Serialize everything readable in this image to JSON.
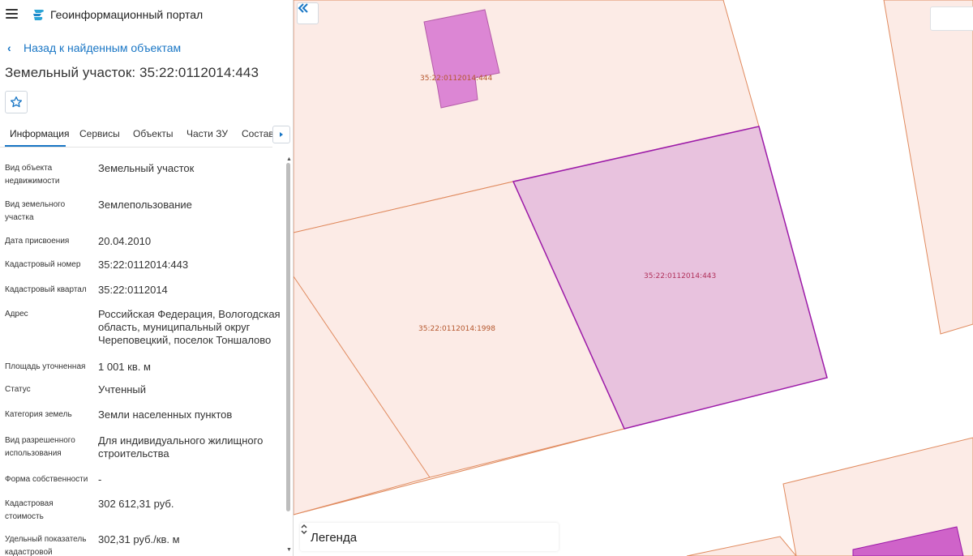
{
  "header": {
    "app_title": "Геоинформационный портал"
  },
  "nav": {
    "back_label": "Назад к найденным объектам"
  },
  "object": {
    "title": "Земельный участок: 35:22:0112014:443"
  },
  "tabs": [
    {
      "label": "Информация",
      "active": true
    },
    {
      "label": "Сервисы"
    },
    {
      "label": "Объекты"
    },
    {
      "label": "Части ЗУ"
    },
    {
      "label": "Состав"
    }
  ],
  "properties": [
    {
      "label": "Вид объекта недвижимости",
      "value": "Земельный участок"
    },
    {
      "label": "Вид земельного участка",
      "value": "Землепользование"
    },
    {
      "label": "Дата присвоения",
      "value": "20.04.2010"
    },
    {
      "label": "Кадастровый номер",
      "value": "35:22:0112014:443"
    },
    {
      "label": "Кадастровый квартал",
      "value": "35:22:0112014"
    },
    {
      "label": "Адрес",
      "value": "Российская Федерация, Вологодская область, муниципальный округ Череповецкий, поселок Тоншалово"
    },
    {
      "label": "Площадь уточненная",
      "value": "1 001 кв. м"
    },
    {
      "label": "Статус",
      "value": "Учтенный"
    },
    {
      "label": "Категория земель",
      "value": "Земли населенных пунктов"
    },
    {
      "label": "Вид разрешенного использования",
      "value": "Для индивидуального жилищного строительства"
    },
    {
      "label": "Форма собственности",
      "value": "-"
    },
    {
      "label": "Кадастровая стоимость",
      "value": "302 612,31 руб."
    },
    {
      "label": "Удельный показатель кадастровой",
      "value": "302,31 руб./кв. м"
    }
  ],
  "map": {
    "parcels": [
      {
        "label": "35:22:0112014:444"
      },
      {
        "label": "35:22:0112014:443"
      },
      {
        "label": "35:22:0112014:1998"
      }
    ],
    "legend_label": "Легенда"
  },
  "colors": {
    "accent": "#1976c5",
    "parcel_fill": "#fcebe6",
    "parcel_stroke": "#e08a5e",
    "selected_fill": "#e8c2de",
    "selected_stroke": "#9c1aa8",
    "building_fill": "#dc86d4"
  }
}
